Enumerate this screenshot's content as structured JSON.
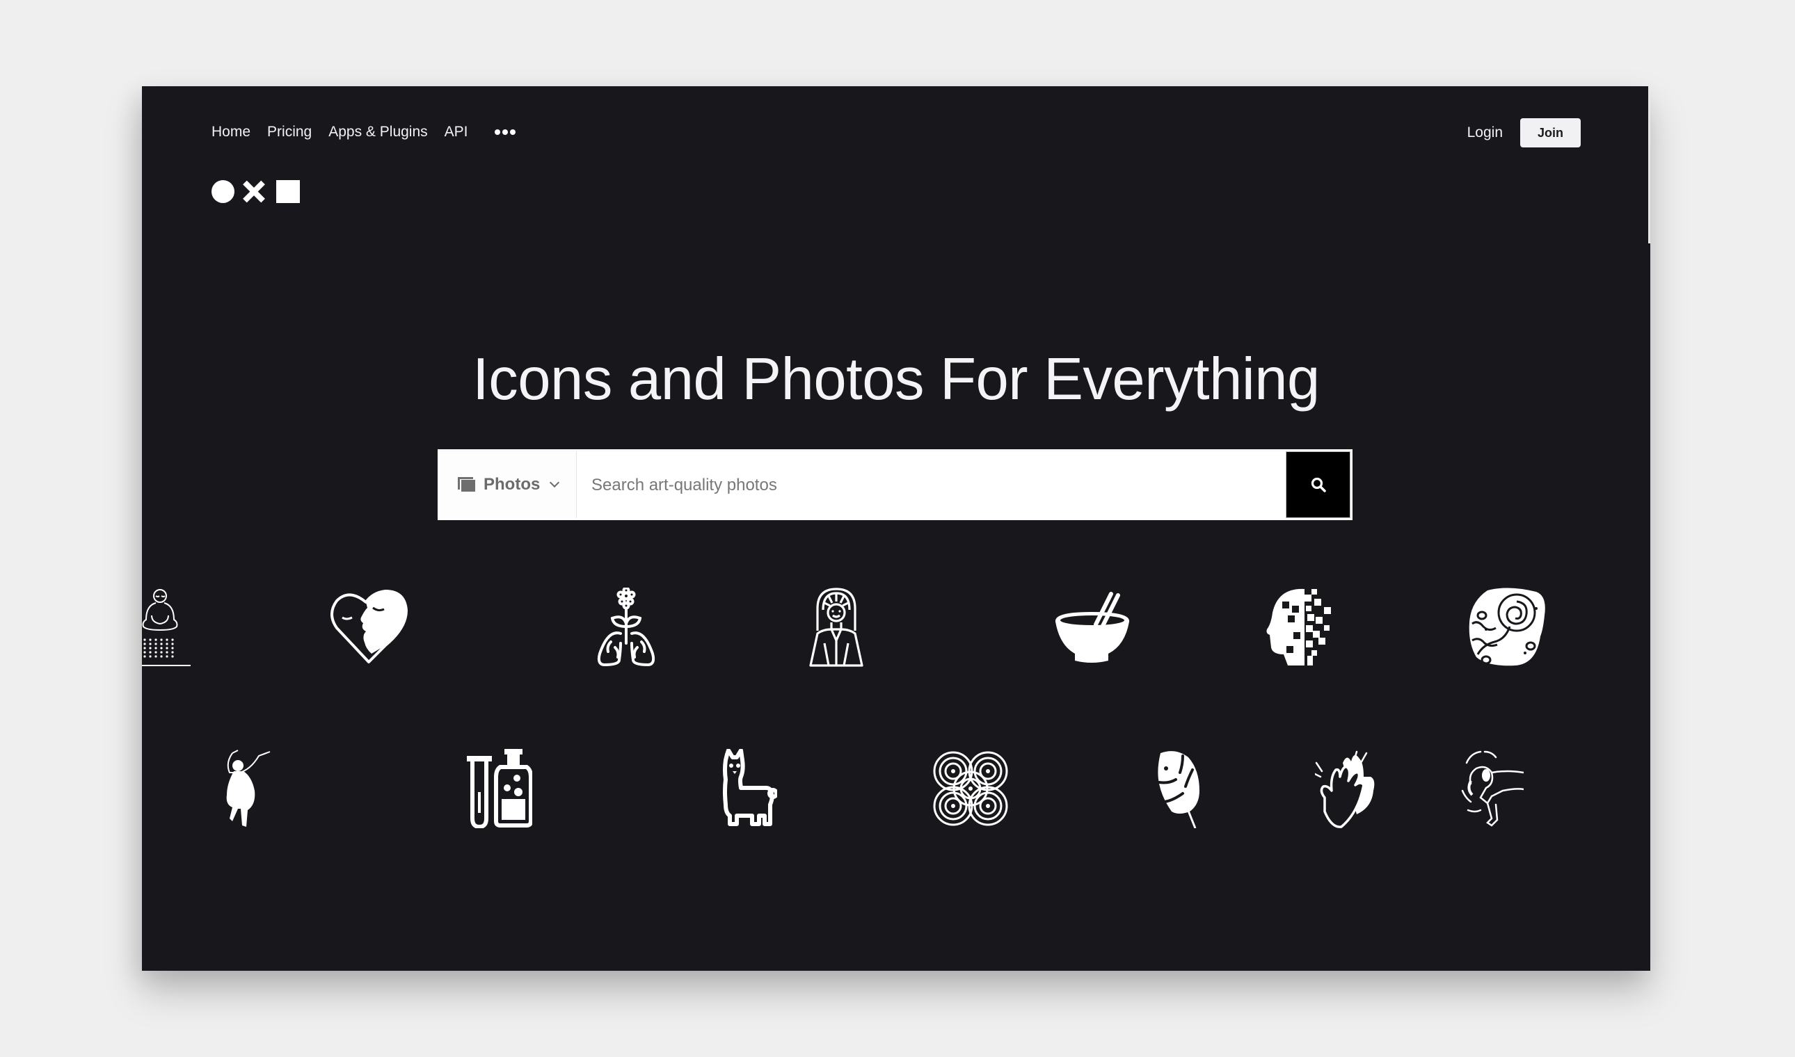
{
  "nav": {
    "items": [
      {
        "label": "Home"
      },
      {
        "label": "Pricing"
      },
      {
        "label": "Apps & Plugins"
      },
      {
        "label": "API"
      }
    ],
    "more_icon": "more-dots-icon"
  },
  "auth": {
    "login_label": "Login",
    "join_label": "Join"
  },
  "logo": {
    "shapes": [
      "circle",
      "cross",
      "square"
    ]
  },
  "hero": {
    "title": "Icons and Photos For Everything"
  },
  "search": {
    "type_selected": "Photos",
    "type_icon": "photo-icon",
    "placeholder": "Search art-quality photos",
    "value": "",
    "button_icon": "search-icon"
  },
  "icon_showcase": {
    "row1": [
      "meditation-person",
      "heart-face",
      "lungs-flower",
      "woman-portrait",
      "bowl-chopsticks",
      "pixel-head",
      "fossil-spiral"
    ],
    "row2": [
      "dancing-woman",
      "lab-bottles",
      "llama",
      "spiral-knot",
      "monstera-leaf",
      "clapping-hands",
      "spinning-dancer"
    ]
  },
  "colors": {
    "page_bg": "#efefef",
    "panel_bg": "#18171c",
    "text_light": "#f2f2f4",
    "search_button": "#000000"
  }
}
